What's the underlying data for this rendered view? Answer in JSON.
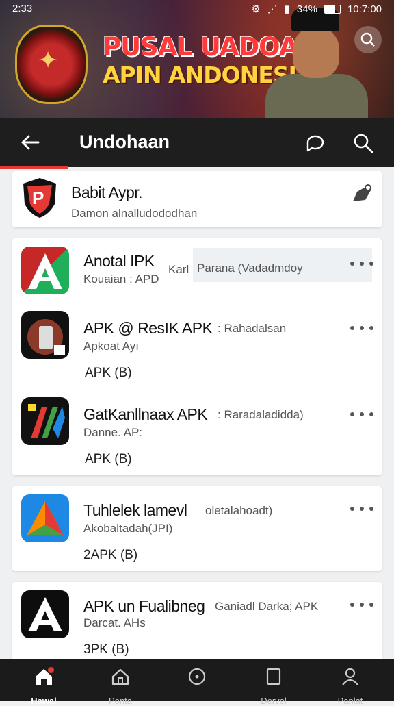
{
  "status": {
    "time": "2:33",
    "battery": "34%",
    "clock_right": "10:7:00"
  },
  "banner": {
    "line1": "PUSAL UADOAN",
    "line2": "APIN ANDONESIA"
  },
  "appbar": {
    "title": "Undohaan"
  },
  "top_card": {
    "name": "Babit Aypr.",
    "sub": "Damon alnalludododhan"
  },
  "apps": [
    {
      "name": "Anotal IPK",
      "sub": "Kouaian : APD",
      "extra_left": "Karl",
      "extra_right": "Parana (Vadadmdoy",
      "apk": ""
    },
    {
      "name": "APK @ ResIK APK",
      "name_suffix": ": Rahadalsan",
      "sub": "Apkoat Ayı",
      "apk": "APK (B)"
    },
    {
      "name": "GatKanllnaax APK",
      "name_suffix": ": Raradaladidda)",
      "sub": "Danne. AP:",
      "apk": "APK (B)"
    },
    {
      "name": "Tuhlelek lamevl",
      "name_suffix": "oletalahoadt)",
      "sub": "Akobaltadah(JPI)",
      "apk": "2APK (B)"
    },
    {
      "name": "APK un Fualibneg",
      "name_suffix": "Ganiadl Darka; APK",
      "sub": "Darcat. AHs",
      "apk": "3PK (B)"
    }
  ],
  "nav": [
    {
      "label": "Hawal",
      "icon": "home-icon"
    },
    {
      "label": "Ponta",
      "icon": "house-outline-icon"
    },
    {
      "label": "",
      "icon": "circle-dot-icon"
    },
    {
      "label": "Dervel",
      "icon": "square-icon"
    },
    {
      "label": "Panlat",
      "icon": "person-icon"
    }
  ],
  "colors": {
    "accent": "#e53935",
    "appbar": "#1e1e1e",
    "bottomnav": "#1b1b1b"
  }
}
